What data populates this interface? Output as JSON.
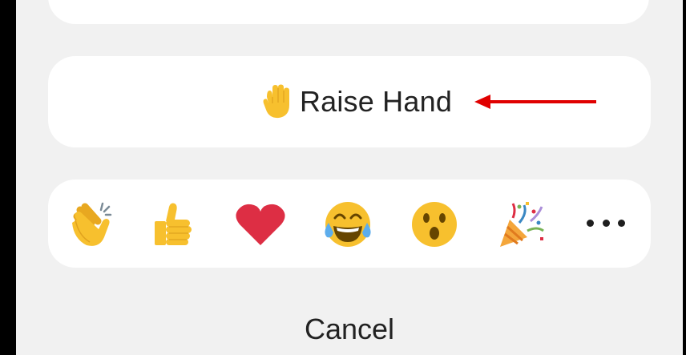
{
  "sheet": {
    "raise_hand_label": "Raise Hand",
    "raise_hand_icon": "raised-hand-icon",
    "annotation_arrow_color": "#e00000",
    "reactions": [
      {
        "name": "clapping-hands-icon"
      },
      {
        "name": "thumbs-up-icon"
      },
      {
        "name": "red-heart-icon"
      },
      {
        "name": "tears-of-joy-icon"
      },
      {
        "name": "surprised-face-icon"
      },
      {
        "name": "party-popper-icon"
      }
    ],
    "more_icon": "more-options-icon",
    "cancel_label": "Cancel"
  },
  "colors": {
    "background": "#f1f1f1",
    "card": "#ffffff",
    "text": "#222222",
    "emoji_yellow": "#f7c02e",
    "heart_red": "#dd2e44"
  }
}
